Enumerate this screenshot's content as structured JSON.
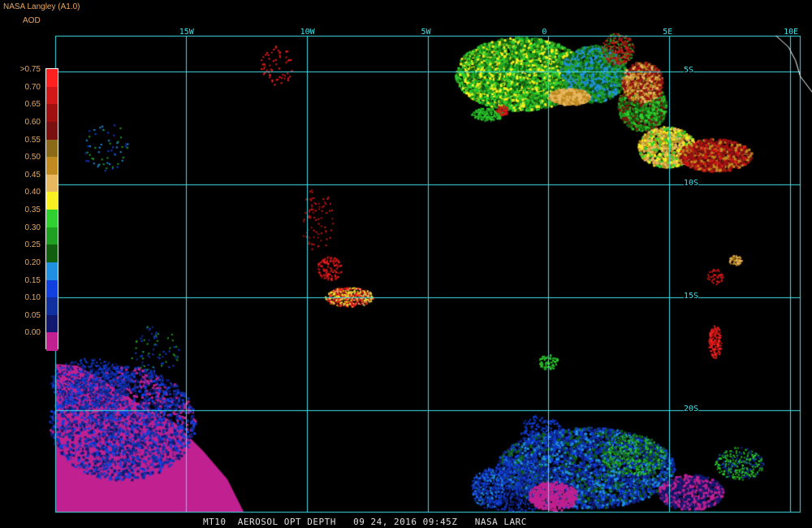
{
  "header": {
    "credit": "NASA Langley (A1.0)",
    "product_label": "AOD"
  },
  "footer": {
    "caption": "MT10  AEROSOL OPT DEPTH   09 24, 2016 09:45Z   NASA LARC"
  },
  "map": {
    "lon_range": [
      -20.4,
      10.4
    ],
    "lat_range": [
      -3.4,
      -24.5
    ],
    "grid_color": "#40e0e8",
    "coast_color": "#ffffff",
    "lon_lines": [
      {
        "lon": -15,
        "label": "15W"
      },
      {
        "lon": -10,
        "label": "10W"
      },
      {
        "lon": -5,
        "label": "5W"
      },
      {
        "lon": 0,
        "label": "0"
      },
      {
        "lon": 5,
        "label": "5E"
      },
      {
        "lon": 10,
        "label": "10E"
      }
    ],
    "lat_lines": [
      {
        "lat": -5,
        "label": "5S"
      },
      {
        "lat": -10,
        "label": "10S"
      },
      {
        "lat": -15,
        "label": "15S"
      },
      {
        "lat": -20,
        "label": "20S"
      }
    ],
    "coastline": [
      [
        9.4,
        -3.4
      ],
      [
        9.9,
        -3.9
      ],
      [
        10.2,
        -4.5
      ],
      [
        10.4,
        -5.2
      ],
      [
        11.0,
        -6.0
      ],
      [
        11.4,
        -7.0
      ],
      [
        11.6,
        -8.0
      ],
      [
        11.9,
        -9.0
      ],
      [
        12.1,
        -9.8
      ],
      [
        12.5,
        -10.8
      ],
      [
        12.4,
        -11.7
      ],
      [
        12.3,
        -12.8
      ],
      [
        12.0,
        -13.8
      ],
      [
        11.7,
        -14.8
      ],
      [
        11.6,
        -15.8
      ],
      [
        11.5,
        -16.8
      ],
      [
        11.4,
        -17.8
      ],
      [
        11.6,
        -18.8
      ],
      [
        11.9,
        -19.8
      ],
      [
        12.2,
        -20.8
      ],
      [
        12.6,
        -21.8
      ],
      [
        13.0,
        -22.8
      ],
      [
        13.5,
        -23.8
      ],
      [
        13.6,
        -24.5
      ]
    ]
  },
  "legend": {
    "title": "AOD",
    "entries": [
      {
        "label": ">0.75",
        "color": "#ff2020"
      },
      {
        "label": "0.70",
        "color": "#d01818"
      },
      {
        "label": "0.65",
        "color": "#a01010"
      },
      {
        "label": "0.60",
        "color": "#7a1010"
      },
      {
        "label": "0.55",
        "color": "#8a6a18"
      },
      {
        "label": "0.50",
        "color": "#c08a20"
      },
      {
        "label": "0.45",
        "color": "#e8b860"
      },
      {
        "label": "0.40",
        "color": "#f8f020"
      },
      {
        "label": "0.35",
        "color": "#30d030"
      },
      {
        "label": "0.30",
        "color": "#20a020"
      },
      {
        "label": "0.25",
        "color": "#106010"
      },
      {
        "label": "0.20",
        "color": "#2090e0"
      },
      {
        "label": "0.15",
        "color": "#1040e0"
      },
      {
        "label": "0.10",
        "color": "#1030a0"
      },
      {
        "label": "0.05",
        "color": "#101870"
      },
      {
        "label": "0.00",
        "color": "#c02090"
      }
    ]
  }
}
